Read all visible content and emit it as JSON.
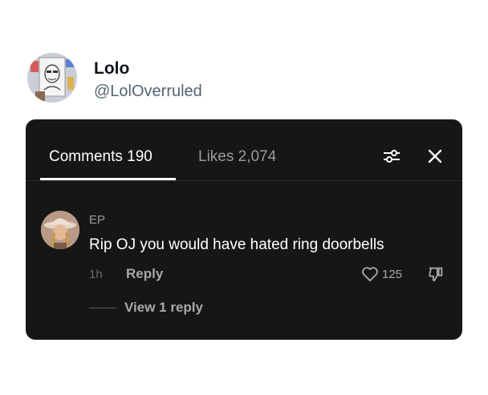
{
  "post": {
    "display_name": "Lolo",
    "handle": "@LolOverruled"
  },
  "panel": {
    "tabs": [
      {
        "label": "Comments 190",
        "active": true
      },
      {
        "label": "Likes 2,074",
        "active": false
      }
    ],
    "icons": {
      "filter": "sliders-icon",
      "close": "close-icon"
    }
  },
  "comment": {
    "username": "EP",
    "text": "Rip OJ you would have hated ring doorbells",
    "time": "1h",
    "reply_label": "Reply",
    "like_count": "125",
    "view_replies_label": "View 1 reply"
  },
  "colors": {
    "panel_bg": "#161616",
    "active_tab": "#ffffff",
    "inactive_tab": "#9b9b9b",
    "handle": "#536471"
  }
}
